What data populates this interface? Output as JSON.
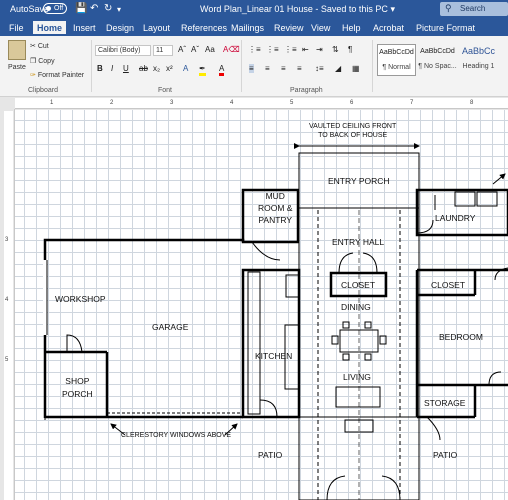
{
  "titlebar": {
    "autosave_label": "AutoSave",
    "toggle_state": "Off",
    "document_title": "Word Plan_Linear 01 House  -  Saved to this PC",
    "search_label": "Search"
  },
  "tabs": [
    "File",
    "Home",
    "Insert",
    "Design",
    "Layout",
    "References",
    "Mailings",
    "Review",
    "View",
    "Help",
    "Acrobat",
    "Picture Format"
  ],
  "active_tab": "Home",
  "ribbon": {
    "clipboard": {
      "paste": "Paste",
      "cut": "Cut",
      "copy": "Copy",
      "format_painter": "Format Painter",
      "group": "Clipboard"
    },
    "font": {
      "name": "Calibri (Body)",
      "size": "11",
      "group": "Font"
    },
    "paragraph": {
      "group": "Paragraph"
    },
    "styles": [
      {
        "sample": "AaBbCcDd",
        "name": "¶ Normal"
      },
      {
        "sample": "AaBbCcDd",
        "name": "¶ No Spac..."
      },
      {
        "sample": "AaBbCc",
        "name": "Heading 1"
      }
    ]
  },
  "ruler": {
    "h_numbers": [
      "1",
      "2",
      "3",
      "4",
      "5",
      "6",
      "7",
      "8"
    ],
    "v_numbers": [
      "3",
      "4",
      "5"
    ]
  },
  "plan": {
    "vaulted_note": "VAULTED CEILING FRONT\nTO BACK OF HOUSE",
    "clerestory_note": "CLERESTORY WINDOWS ABOVE",
    "rooms": {
      "entry_porch": "ENTRY PORCH",
      "mud_room": "MUD\nROOM &\nPANTRY",
      "entry_hall": "ENTRY HALL",
      "closet_center": "CLOSET",
      "laundry": "LAUNDRY",
      "workshop": "WORKSHOP",
      "garage": "GARAGE",
      "closet_right": "CLOSET",
      "dining": "DINING",
      "kitchen": "KITCHEN",
      "bedroom": "BEDROOM",
      "living": "LIVING",
      "shop_porch": "SHOP\nPORCH",
      "storage": "STORAGE",
      "patio_left": "PATIO",
      "patio_right": "PATIO"
    }
  }
}
